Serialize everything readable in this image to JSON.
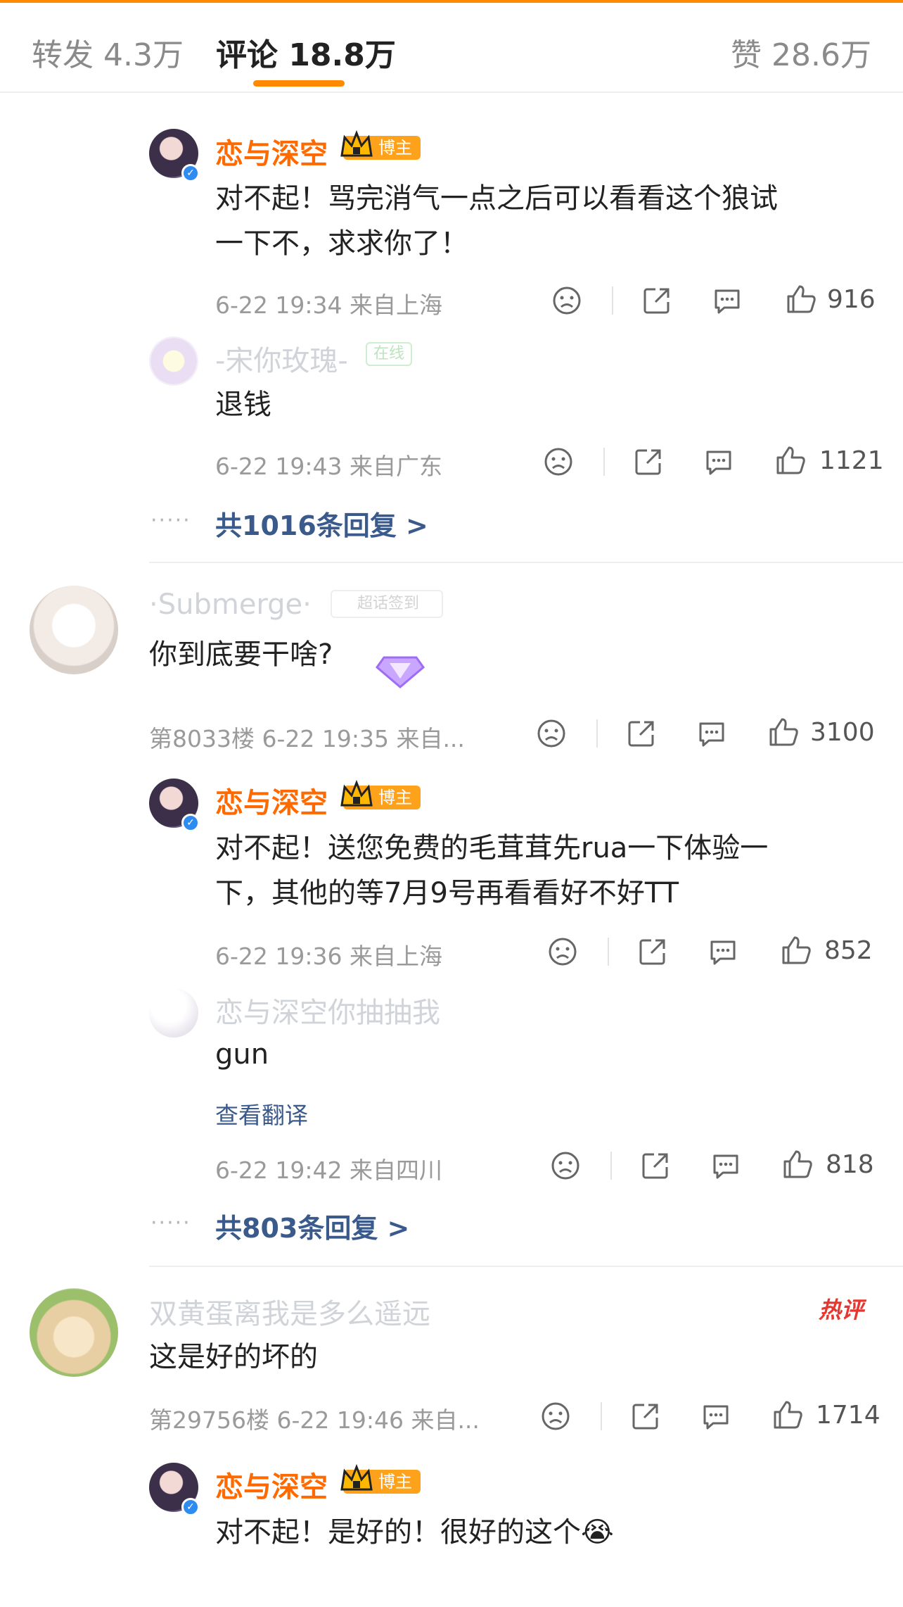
{
  "tabs": {
    "repost": "转发 4.3万",
    "comments": "评论 18.8万",
    "likes": "赞 28.6万"
  },
  "thread1": {
    "reply1": {
      "name": "恋与深空",
      "badge": "博主",
      "text_line1": "对不起！骂完消气一点之后可以看看这个狼试",
      "text_line2": "一下不，求求你了！",
      "meta": "6-22 19:34 来自上海",
      "likes": "916"
    },
    "reply2": {
      "name": "-宋你玫瑰-",
      "badge": "在线",
      "text": "退钱",
      "meta": "6-22 19:43 来自广东",
      "likes": "1121"
    },
    "more_dots": "·····",
    "more_replies": "共1016条回复 >"
  },
  "comment2": {
    "name": "·Submerge·",
    "badge": "超话签到",
    "text": "你到底要干啥?",
    "meta": "第8033楼 6-22 19:35 来自...",
    "likes": "3100",
    "reply1": {
      "name": "恋与深空",
      "badge": "博主",
      "text_line1": "对不起！送您免费的毛茸茸先rua一下体验一",
      "text_line2": "下，其他的等7月9号再看看好不好TT",
      "meta": "6-22 19:36 来自上海",
      "likes": "852"
    },
    "reply2": {
      "name": "恋与深空你抽抽我",
      "text": "gun",
      "translate": "查看翻译",
      "meta": "6-22 19:42 来自四川",
      "likes": "818"
    },
    "more_dots": "·····",
    "more_replies": "共803条回复 >"
  },
  "comment3": {
    "name": "双黄蛋离我是多么遥远",
    "hot_label": "热评",
    "text": "这是好的坏的",
    "meta": "第29756楼 6-22 19:46 来自...",
    "likes": "1714",
    "reply1": {
      "name": "恋与深空",
      "badge": "博主",
      "text": "对不起！是好的！很好的这个😭"
    }
  },
  "colors": {
    "accent": "#ff8a00",
    "host_name": "#ff6a00",
    "link": "#3a5a8c",
    "hot": "#e8352e"
  }
}
